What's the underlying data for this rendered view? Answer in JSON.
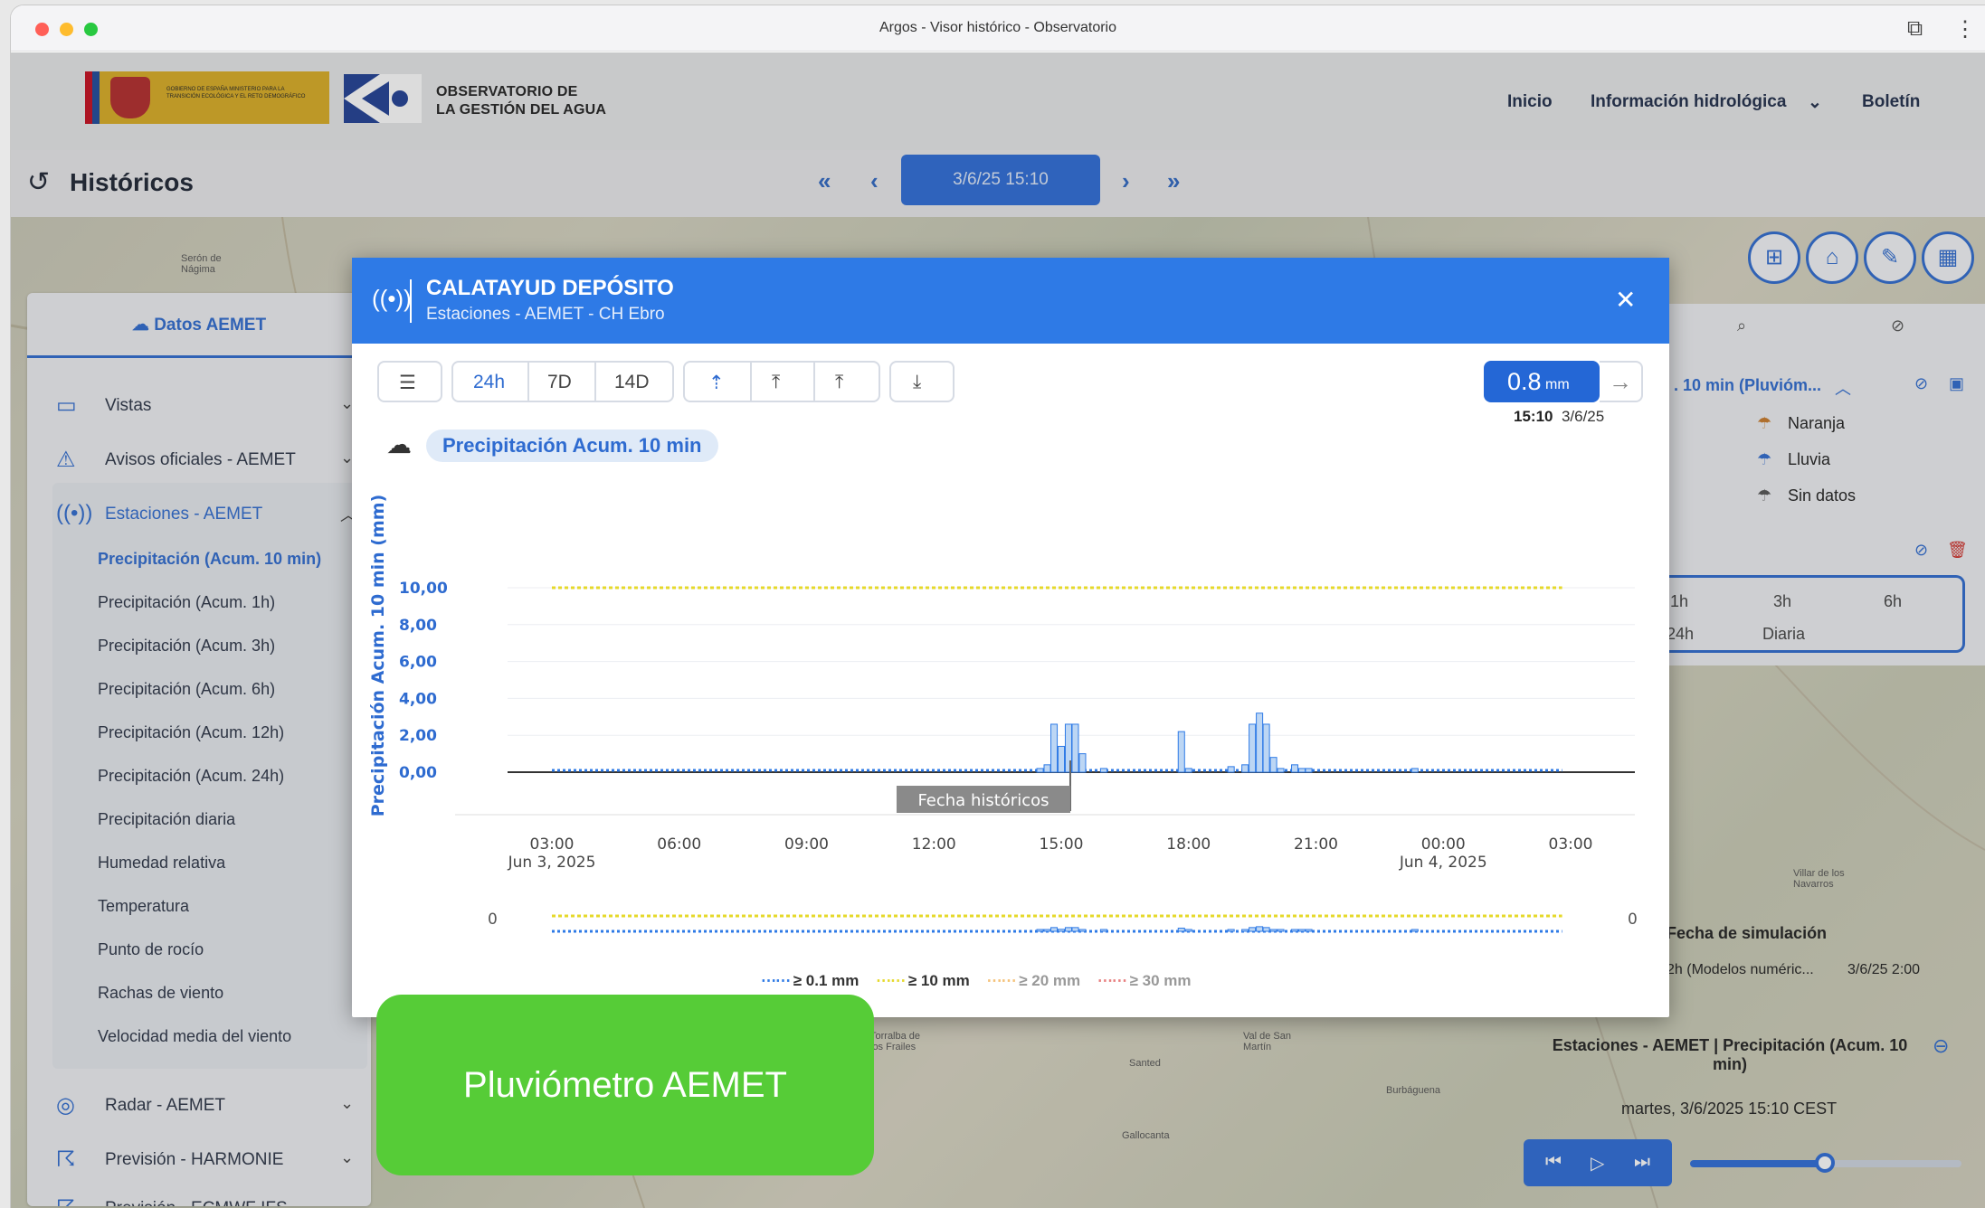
{
  "window": {
    "title": "Argos - Visor histórico - Observatorio"
  },
  "header": {
    "gov_text": "GOBIERNO DE ESPAÑA   MINISTERIO PARA LA TRANSICIÓN ECOLÓGICA Y EL RETO DEMOGRÁFICO",
    "org_line1": "OBSERVATORIO DE",
    "org_line2": "LA GESTIÓN DEL AGUA",
    "nav": [
      "Inicio",
      "Información hidrológica",
      "Boletín"
    ]
  },
  "history": {
    "title": "Históricos",
    "date": "3/6/25 15:10"
  },
  "sidebar": {
    "tab": "Datos AEMET",
    "items": [
      {
        "label": "Vistas",
        "icon": "monitor-icon"
      },
      {
        "label": "Avisos oficiales - AEMET",
        "icon": "warning-icon"
      },
      {
        "label": "Estaciones - AEMET",
        "icon": "antenna-icon"
      }
    ],
    "subitems": [
      "Precipitación (Acum. 10 min)",
      "Precipitación (Acum. 1h)",
      "Precipitación (Acum. 3h)",
      "Precipitación (Acum. 6h)",
      "Precipitación (Acum. 12h)",
      "Precipitación (Acum. 24h)",
      "Precipitación diaria",
      "Humedad relativa",
      "Temperatura",
      "Punto de rocío",
      "Rachas de viento",
      "Velocidad media del viento"
    ],
    "bottom": [
      "Radar - AEMET",
      "Previsión - HARMONIE",
      "Previsión - ECMWF IFS"
    ]
  },
  "right_panel": {
    "layer_title": ". 10 min (Pluvióm...",
    "legend": [
      "Naranja",
      "Lluvia",
      "Sin datos"
    ],
    "periods": [
      "1h",
      "3h",
      "6h",
      "24h",
      "Diaria"
    ],
    "sim_title": "Fecha de simulación",
    "sim_model": "2h (Modelos numéric...",
    "sim_date": "3/6/25 2:00",
    "layer_name": "Estaciones - AEMET | Precipitación (Acum. 10 min)",
    "layer_date": "martes, 3/6/2025 15:10 CEST"
  },
  "modal": {
    "title": "CALATAYUD DEPÓSITO",
    "subtitle": "Estaciones - AEMET - CH Ebro",
    "ranges": [
      "24h",
      "7D",
      "14D"
    ],
    "value": "0.8",
    "unit": "mm",
    "value_time": "15:10",
    "value_date": "3/6/25",
    "variable": "Precipitación Acum. 10 min",
    "marker_label": "Fecha históricos",
    "navigator_left": "0",
    "navigator_right": "0",
    "legend": [
      "≥ 0.1 mm",
      "≥ 10 mm",
      "≥ 20 mm",
      "≥ 30 mm"
    ],
    "legend_colors": [
      "#2e7ae6",
      "#e6d92a",
      "#f5c27a",
      "#e88080"
    ]
  },
  "chart_data": {
    "type": "bar",
    "ylabel": "Precipitación Acum. 10 min (mm)",
    "ylim": [
      0,
      10
    ],
    "yticks": [
      "10,00",
      "8,00",
      "6,00",
      "4,00",
      "2,00",
      "0,00"
    ],
    "xticks": [
      {
        "t": "03:00",
        "d": "Jun 3, 2025"
      },
      {
        "t": "06:00",
        "d": ""
      },
      {
        "t": "09:00",
        "d": ""
      },
      {
        "t": "12:00",
        "d": ""
      },
      {
        "t": "15:00",
        "d": ""
      },
      {
        "t": "18:00",
        "d": ""
      },
      {
        "t": "21:00",
        "d": ""
      },
      {
        "t": "00:00",
        "d": "Jun 4, 2025"
      },
      {
        "t": "03:00",
        "d": ""
      }
    ],
    "x_start_hour": 3,
    "x_end_hour": 27,
    "threshold": 10,
    "marker_hour": 15.17,
    "series": [
      {
        "values": [
          [
            14.5,
            0.2
          ],
          [
            14.67,
            0.4
          ],
          [
            14.83,
            2.6
          ],
          [
            15.0,
            1.4
          ],
          [
            15.17,
            2.6
          ],
          [
            15.33,
            2.6
          ],
          [
            15.5,
            1.0
          ],
          [
            16.0,
            0.2
          ],
          [
            17.83,
            2.2
          ],
          [
            18.0,
            0.2
          ],
          [
            19.0,
            0.3
          ],
          [
            19.33,
            0.4
          ],
          [
            19.5,
            2.6
          ],
          [
            19.67,
            3.2
          ],
          [
            19.83,
            2.6
          ],
          [
            20.0,
            0.8
          ],
          [
            20.17,
            0.2
          ],
          [
            20.5,
            0.4
          ],
          [
            20.67,
            0.2
          ],
          [
            20.83,
            0.2
          ],
          [
            23.33,
            0.2
          ]
        ]
      }
    ]
  }
}
